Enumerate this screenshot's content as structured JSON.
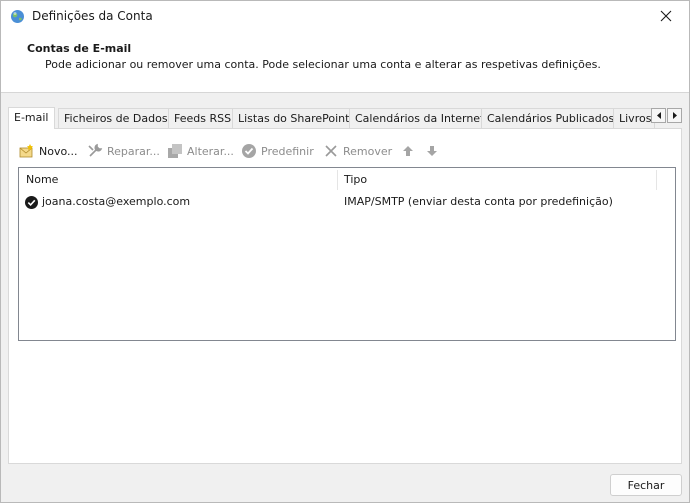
{
  "window": {
    "title": "Definições da Conta",
    "icon": "globe-icon"
  },
  "header": {
    "title": "Contas de E-mail",
    "description": "Pode adicionar ou remover uma conta. Pode selecionar uma conta e alterar as respetivas definições."
  },
  "tabs": [
    {
      "label": "E-mail",
      "active": true
    },
    {
      "label": "Ficheiros de Dados",
      "active": false
    },
    {
      "label": "Feeds RSS",
      "active": false
    },
    {
      "label": "Listas do SharePoint",
      "active": false
    },
    {
      "label": "Calendários da Internet",
      "active": false
    },
    {
      "label": "Calendários Publicados",
      "active": false
    },
    {
      "label": "Livros",
      "active": false
    }
  ],
  "toolbar": {
    "new": "Novo...",
    "repair": "Reparar...",
    "change": "Alterar...",
    "set_default": "Predefinir",
    "remove": "Remover"
  },
  "accounts_list": {
    "columns": [
      "Nome",
      "Tipo"
    ],
    "rows": [
      {
        "name": "joana.costa@exemplo.com",
        "type": "IMAP/SMTP (enviar desta conta por predefinição)",
        "is_default": true
      }
    ]
  },
  "footer": {
    "close": "Fechar"
  }
}
